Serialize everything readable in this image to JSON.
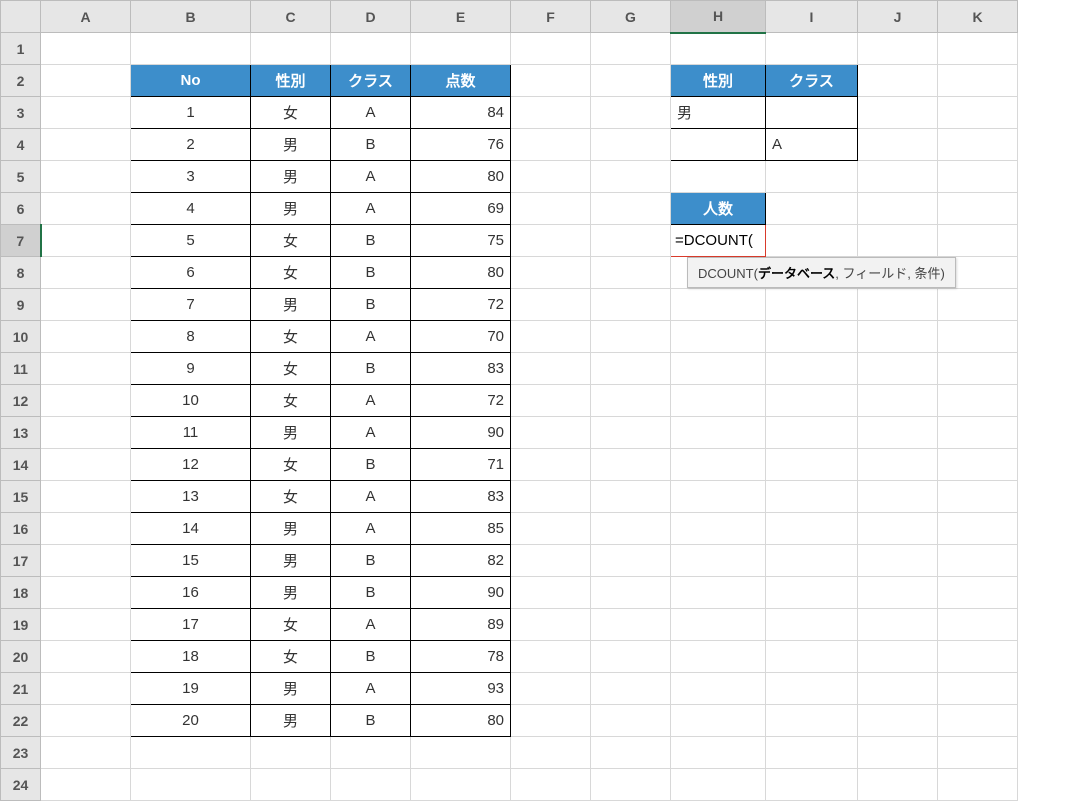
{
  "columns": [
    "A",
    "B",
    "C",
    "D",
    "E",
    "F",
    "G",
    "H",
    "I",
    "J",
    "K"
  ],
  "rowCount": 24,
  "mainHeaders": {
    "no": "No",
    "gender": "性別",
    "class": "クラス",
    "score": "点数"
  },
  "rows": [
    {
      "no": "1",
      "gender": "女",
      "class": "A",
      "score": "84"
    },
    {
      "no": "2",
      "gender": "男",
      "class": "B",
      "score": "76"
    },
    {
      "no": "3",
      "gender": "男",
      "class": "A",
      "score": "80"
    },
    {
      "no": "4",
      "gender": "男",
      "class": "A",
      "score": "69"
    },
    {
      "no": "5",
      "gender": "女",
      "class": "B",
      "score": "75"
    },
    {
      "no": "6",
      "gender": "女",
      "class": "B",
      "score": "80"
    },
    {
      "no": "7",
      "gender": "男",
      "class": "B",
      "score": "72"
    },
    {
      "no": "8",
      "gender": "女",
      "class": "A",
      "score": "70"
    },
    {
      "no": "9",
      "gender": "女",
      "class": "B",
      "score": "83"
    },
    {
      "no": "10",
      "gender": "女",
      "class": "A",
      "score": "72"
    },
    {
      "no": "11",
      "gender": "男",
      "class": "A",
      "score": "90"
    },
    {
      "no": "12",
      "gender": "女",
      "class": "B",
      "score": "71"
    },
    {
      "no": "13",
      "gender": "女",
      "class": "A",
      "score": "83"
    },
    {
      "no": "14",
      "gender": "男",
      "class": "A",
      "score": "85"
    },
    {
      "no": "15",
      "gender": "男",
      "class": "B",
      "score": "82"
    },
    {
      "no": "16",
      "gender": "男",
      "class": "B",
      "score": "90"
    },
    {
      "no": "17",
      "gender": "女",
      "class": "A",
      "score": "89"
    },
    {
      "no": "18",
      "gender": "女",
      "class": "B",
      "score": "78"
    },
    {
      "no": "19",
      "gender": "男",
      "class": "A",
      "score": "93"
    },
    {
      "no": "20",
      "gender": "男",
      "class": "B",
      "score": "80"
    }
  ],
  "criteria": {
    "headers": {
      "gender": "性別",
      "class": "クラス"
    },
    "row1": {
      "gender": "男",
      "class": ""
    },
    "row2": {
      "gender": "",
      "class": "A"
    }
  },
  "result": {
    "header": "人数",
    "formula": "=DCOUNT("
  },
  "tooltip": {
    "fn": "DCOUNT(",
    "arg1": "データベース",
    "rest": ", フィールド, 条件)"
  }
}
